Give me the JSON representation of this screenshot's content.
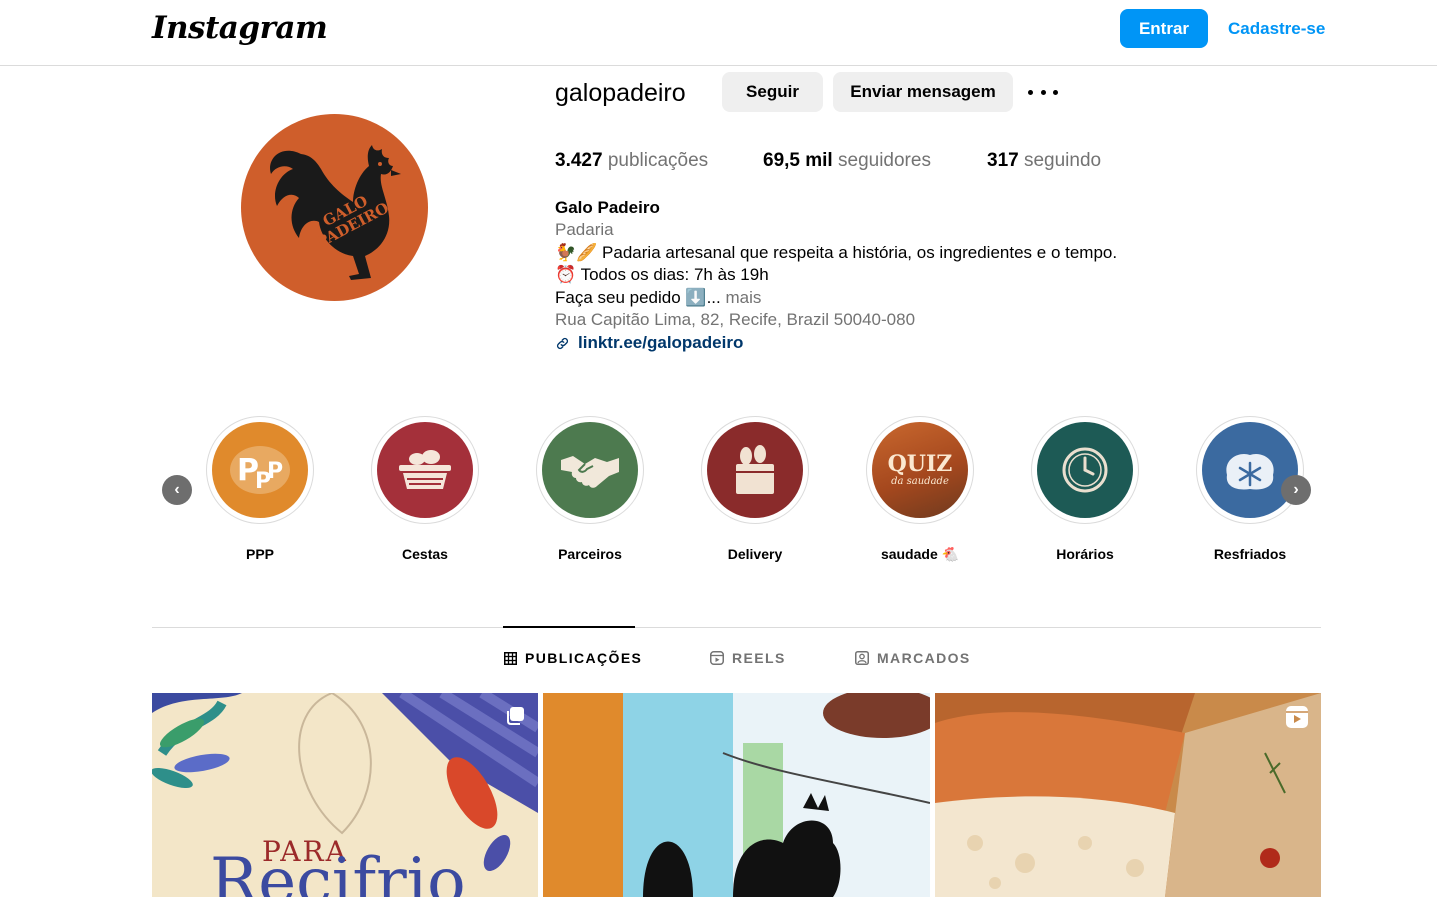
{
  "header": {
    "logo_text": "Instagram",
    "login_label": "Entrar",
    "signup_label": "Cadastre-se",
    "accent_color": "#0095f6"
  },
  "profile": {
    "username": "galopadeiro",
    "follow_label": "Seguir",
    "message_label": "Enviar mensagem",
    "avatar_text": "GALO PADEIRO",
    "stats": [
      {
        "count": "3.427",
        "label": "publicações"
      },
      {
        "count": "69,5 mil",
        "label": "seguidores"
      },
      {
        "count": "317",
        "label": "seguindo"
      }
    ],
    "name": "Galo Padeiro",
    "category": "Padaria",
    "bio_line1": "🐓🥖 Padaria artesanal que respeita a história, os ingredientes e o tempo.",
    "bio_line2": "⏰ Todos os dias: 7h às 19h",
    "bio_line3": "Faça seu pedido ⬇️...",
    "bio_more": "mais",
    "address": "Rua Capitão Lima, 82, Recife, Brazil 50040-080",
    "link": "linktr.ee/galopadeiro"
  },
  "highlights": [
    {
      "label": "PPP",
      "color": "#e08a2c",
      "icon": "ppp-logo-icon"
    },
    {
      "label": "Cestas",
      "color": "#a4303a",
      "icon": "bread-basket-icon"
    },
    {
      "label": "Parceiros",
      "color": "#4d7a4f",
      "icon": "handshake-icon"
    },
    {
      "label": "Delivery",
      "color": "#8a2b2b",
      "icon": "delivery-bag-icon"
    },
    {
      "label": "saudade 🐔",
      "color": "#c9682e",
      "icon": "quiz-image"
    },
    {
      "label": "Horários",
      "color": "#1d5a55",
      "icon": "clock-icon"
    },
    {
      "label": "Resfriados",
      "color": "#3b6aa0",
      "icon": "snowflake-bread-icon"
    }
  ],
  "highlight_quiz_text": "QUIZ",
  "highlight_quiz_sub": "da saudade",
  "tabs": [
    {
      "label": "PUBLICAÇÕES",
      "icon": "grid-icon"
    },
    {
      "label": "REELS",
      "icon": "reels-icon"
    },
    {
      "label": "MARCADOS",
      "icon": "tagged-icon"
    }
  ],
  "posts": [
    {
      "text_top": "PARA",
      "text_main": "Recifrio",
      "badge": "carousel-icon"
    },
    {
      "badge": ""
    },
    {
      "badge": "reel-icon"
    }
  ]
}
